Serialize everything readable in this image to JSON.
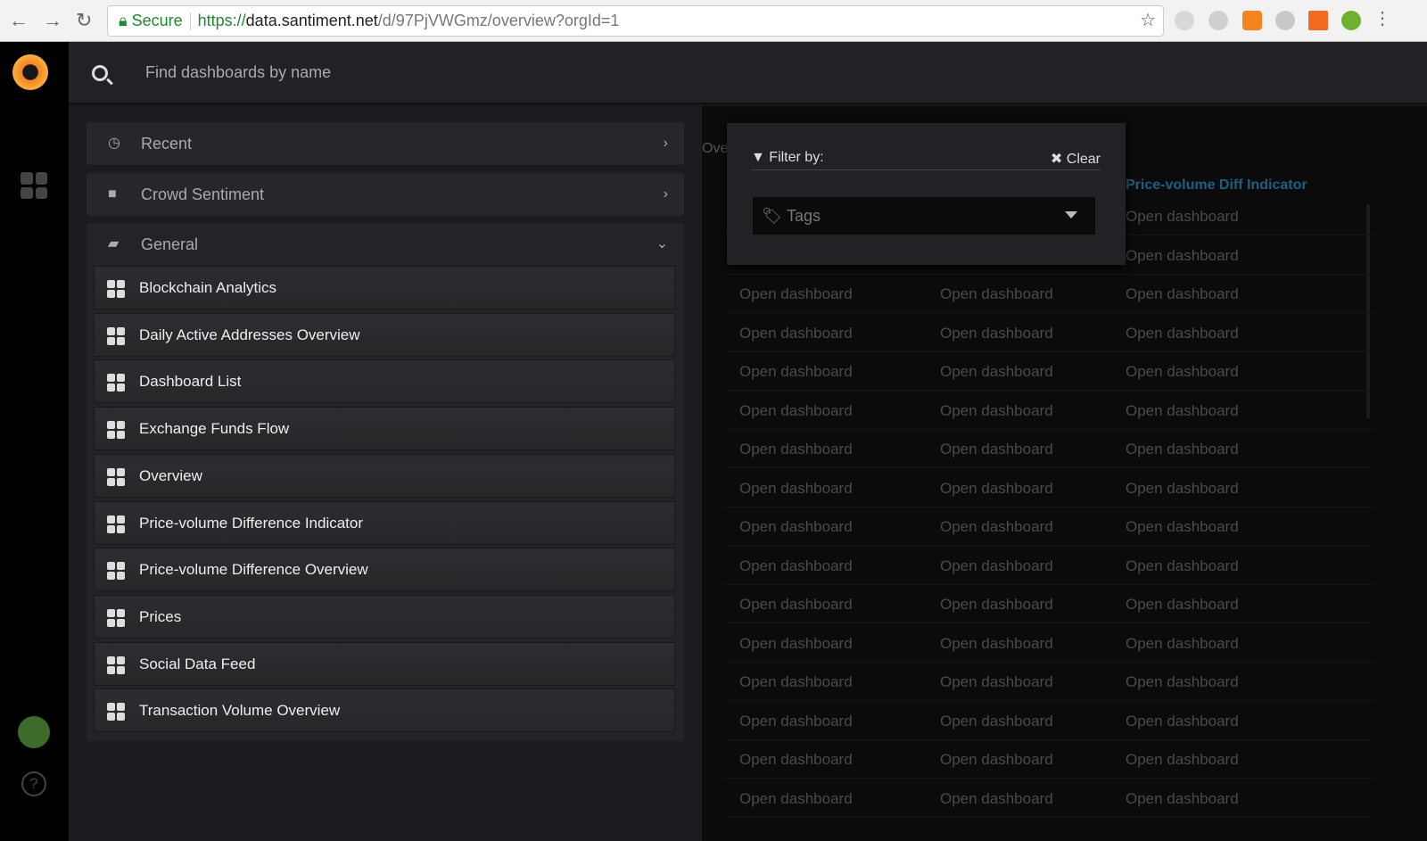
{
  "browser": {
    "back": "←",
    "forward": "→",
    "reload": "↻",
    "secure_label": "Secure",
    "url_scheme": "https://",
    "url_domain": "data.santiment.net",
    "url_path": "/d/97PjVWGmz/overview?orgId=1",
    "extensions": [
      {
        "name": "s-ext",
        "color": "#d8d8d8"
      },
      {
        "name": "circle-ext",
        "color": "#cfcfcf"
      },
      {
        "name": "metamask",
        "color": "#f5841f"
      },
      {
        "name": "grey-ext",
        "color": "#c8c8c8"
      },
      {
        "name": "chart-ext",
        "color": "#f26b21"
      },
      {
        "name": "check-ext",
        "color": "#6bb32c"
      }
    ]
  },
  "search": {
    "placeholder": "Find dashboards by name"
  },
  "folders": [
    {
      "label": "Recent",
      "icon": "clock-icon"
    },
    {
      "label": "Crowd Sentiment",
      "icon": "folder-icon"
    }
  ],
  "general": {
    "label": "General",
    "icon": "folder-open-icon",
    "dashboards": [
      "Blockchain Analytics",
      "Daily Active Addresses Overview",
      "Dashboard List",
      "Exchange Funds Flow",
      "Overview",
      "Price-volume Difference Indicator",
      "Price-volume Difference Overview",
      "Prices",
      "Social Data Feed",
      "Transaction Volume Overview"
    ]
  },
  "background": {
    "partial_label": "Ove",
    "column_header": "Price-volume Diff Indicator",
    "link_text": "Open dashboard"
  },
  "filter": {
    "title": "Filter by:",
    "clear": "Clear",
    "tags_placeholder": "Tags"
  },
  "help": "?"
}
